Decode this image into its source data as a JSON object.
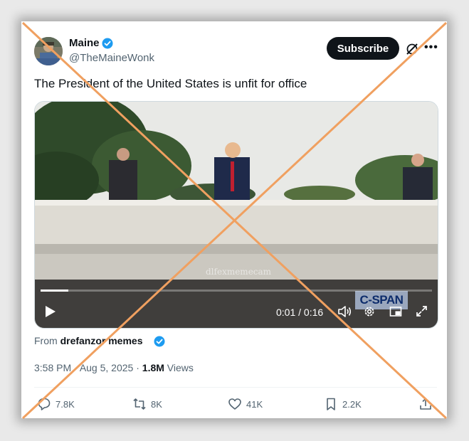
{
  "author": {
    "display_name": "Maine",
    "handle": "@TheMaineWonk",
    "subscribe_label": "Subscribe",
    "more_label": "•••"
  },
  "tweet": {
    "text": "The President of the United States is unfit for office"
  },
  "video": {
    "time_display": "0:01 / 0:16",
    "watermark": "dlfexmemecam",
    "channel_logo": "C-SPAN",
    "progress": 0.07
  },
  "source": {
    "prefix": "From",
    "name": "drefanzor memes"
  },
  "meta": {
    "time": "3:58 PM",
    "date": "Aug 5, 2025",
    "views_count": "1.8M",
    "views_label": "Views"
  },
  "actions": {
    "replies": "7.8K",
    "reposts": "8K",
    "likes": "41K",
    "bookmarks": "2.2K"
  },
  "icons": [
    "verified-badge-icon",
    "grok-icon",
    "more-icon",
    "play-icon",
    "volume-icon",
    "settings-icon",
    "picture-in-picture-icon",
    "fullscreen-icon",
    "reply-icon",
    "repost-icon",
    "like-icon",
    "bookmark-icon",
    "share-icon"
  ],
  "colors": {
    "verified_blue": "#1d9bf0",
    "cross_overlay": "#f0a060",
    "text_primary": "#0f1419",
    "text_secondary": "#536471"
  }
}
